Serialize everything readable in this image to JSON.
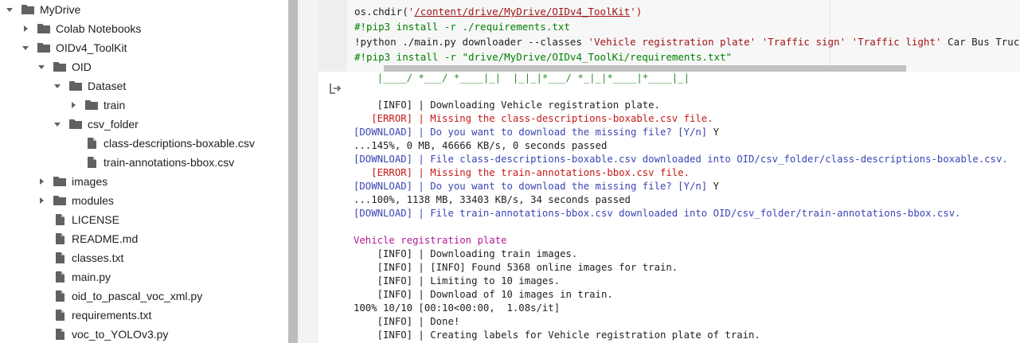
{
  "sidebar": {
    "items": [
      {
        "label": "MyDrive",
        "type": "folder",
        "expanded": true,
        "depth": 0
      },
      {
        "label": "Colab Notebooks",
        "type": "folder",
        "expanded": false,
        "depth": 1
      },
      {
        "label": "OIDv4_ToolKit",
        "type": "folder",
        "expanded": true,
        "depth": 1
      },
      {
        "label": "OID",
        "type": "folder",
        "expanded": true,
        "depth": 2
      },
      {
        "label": "Dataset",
        "type": "folder",
        "expanded": true,
        "depth": 3
      },
      {
        "label": "train",
        "type": "folder",
        "expanded": false,
        "depth": 4
      },
      {
        "label": "csv_folder",
        "type": "folder",
        "expanded": true,
        "depth": 3
      },
      {
        "label": "class-descriptions-boxable.csv",
        "type": "file",
        "depth": 4
      },
      {
        "label": "train-annotations-bbox.csv",
        "type": "file",
        "depth": 4
      },
      {
        "label": "images",
        "type": "folder",
        "expanded": false,
        "depth": 2
      },
      {
        "label": "modules",
        "type": "folder",
        "expanded": false,
        "depth": 2
      },
      {
        "label": "LICENSE",
        "type": "file",
        "depth": 2
      },
      {
        "label": "README.md",
        "type": "file",
        "depth": 2
      },
      {
        "label": "classes.txt",
        "type": "file",
        "depth": 2
      },
      {
        "label": "main.py",
        "type": "file",
        "depth": 2
      },
      {
        "label": "oid_to_pascal_voc_xml.py",
        "type": "file",
        "depth": 2
      },
      {
        "label": "requirements.txt",
        "type": "file",
        "depth": 2
      },
      {
        "label": "voc_to_YOLOv3.py",
        "type": "file",
        "depth": 2
      }
    ]
  },
  "code": {
    "line1_a": "os.chdir(",
    "line1_b": "'",
    "line1_link": "/content/drive/MyDrive/OIDv4_ToolKit",
    "line1_c": "')",
    "line2": "#!pip3 install -r ./requirements.txt",
    "line3_a": "!python ./main.py downloader --classes ",
    "line3_b": "'Vehicle registration plate' 'Traffic sign' 'Traffic light'",
    "line3_c": " Car Bus Truck Person",
    "line4": "#!pip3 install -r \"drive/MyDrive/OIDv4_ToolKi/requirements.txt\""
  },
  "output": {
    "lines": [
      {
        "text": "    |____/ *___/ *____|_|  |_|_|*___/ *_|_|*____|*____|_|",
        "cls": "green"
      },
      {
        "text": "",
        "cls": ""
      },
      {
        "text": "    [INFO] | Downloading Vehicle registration plate.",
        "cls": ""
      },
      {
        "text": "   [ERROR] | Missing the class-descriptions-boxable.csv file.",
        "cls": "red"
      },
      {
        "text": "[DOWNLOAD] | Do you want to download the missing file? [Y/n]",
        "cls": "blue",
        "suffix": " Y"
      },
      {
        "text": "...145%, 0 MB, 46666 KB/s, 0 seconds passed",
        "cls": ""
      },
      {
        "text": "[DOWNLOAD] | File class-descriptions-boxable.csv downloaded into OID/csv_folder/class-descriptions-boxable.csv.",
        "cls": "blue"
      },
      {
        "text": "   [ERROR] | Missing the train-annotations-bbox.csv file.",
        "cls": "red"
      },
      {
        "text": "[DOWNLOAD] | Do you want to download the missing file? [Y/n]",
        "cls": "blue",
        "suffix": " Y"
      },
      {
        "text": "...100%, 1138 MB, 33403 KB/s, 34 seconds passed",
        "cls": ""
      },
      {
        "text": "[DOWNLOAD] | File train-annotations-bbox.csv downloaded into OID/csv_folder/train-annotations-bbox.csv.",
        "cls": "blue"
      },
      {
        "text": "",
        "cls": ""
      },
      {
        "text": "Vehicle registration plate",
        "cls": "purple"
      },
      {
        "text": "    [INFO] | Downloading train images.",
        "cls": ""
      },
      {
        "text": "    [INFO] | [INFO] Found 5368 online images for train.",
        "cls": ""
      },
      {
        "text": "    [INFO] | Limiting to 10 images.",
        "cls": ""
      },
      {
        "text": "    [INFO] | Download of 10 images in train.",
        "cls": ""
      },
      {
        "text": "100% 10/10 [00:10<00:00,  1.08s/it]",
        "cls": ""
      },
      {
        "text": "    [INFO] | Done!",
        "cls": ""
      },
      {
        "text": "    [INFO] | Creating labels for Vehicle registration plate of train.",
        "cls": ""
      }
    ]
  }
}
